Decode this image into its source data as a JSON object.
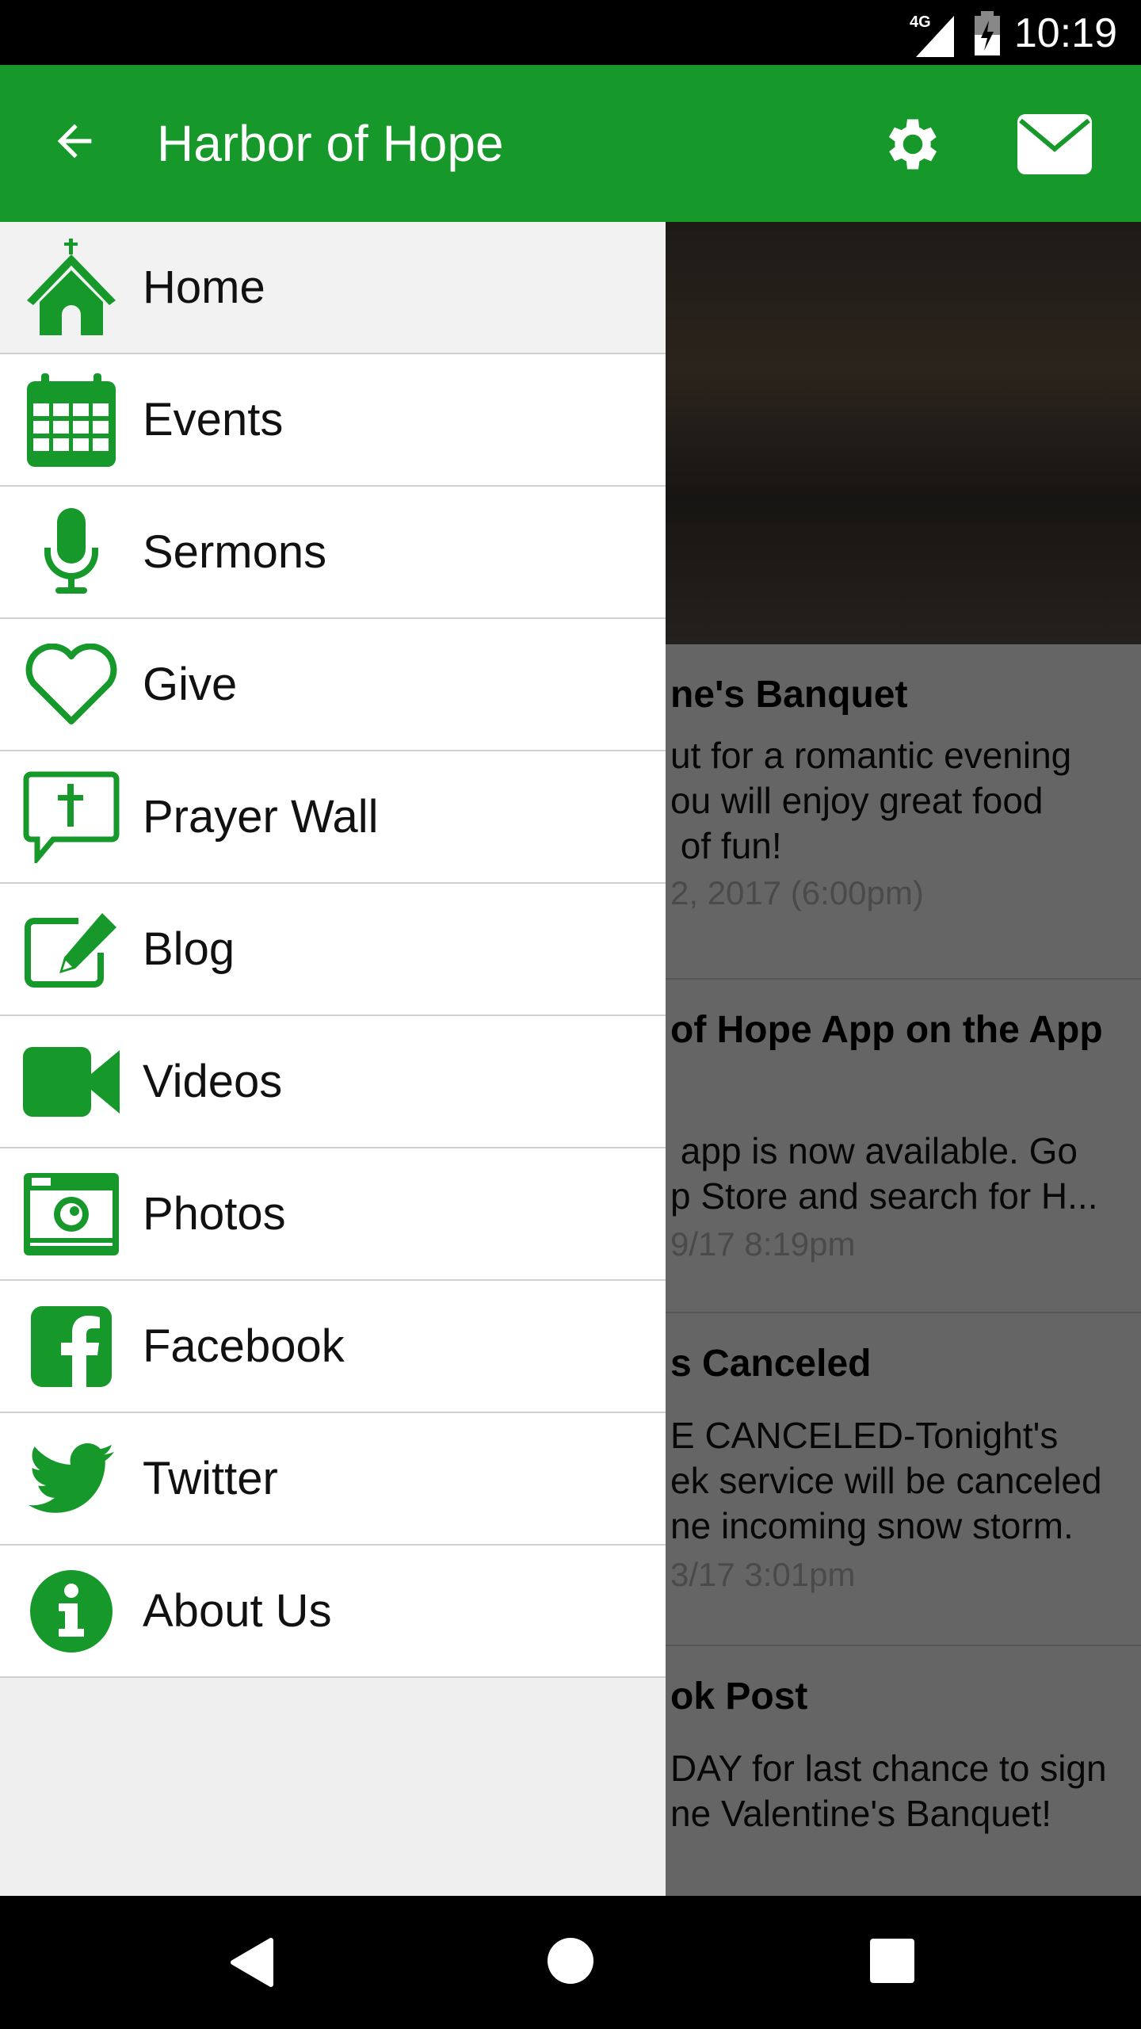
{
  "colors": {
    "accent": "#16982a"
  },
  "status_bar": {
    "network": "4G",
    "time": "10:19"
  },
  "app_bar": {
    "title": "Harbor of Hope",
    "icons": [
      "arrow-back-icon",
      "gear-icon",
      "mail-icon"
    ]
  },
  "drawer": {
    "items": [
      {
        "label": "Home",
        "icon": "home-church-icon",
        "active": true
      },
      {
        "label": "Events",
        "icon": "calendar-icon"
      },
      {
        "label": "Sermons",
        "icon": "microphone-icon"
      },
      {
        "label": "Give",
        "icon": "heart-icon"
      },
      {
        "label": "Prayer Wall",
        "icon": "chat-cross-icon"
      },
      {
        "label": "Blog",
        "icon": "edit-icon"
      },
      {
        "label": "Videos",
        "icon": "video-camera-icon"
      },
      {
        "label": "Photos",
        "icon": "camera-icon"
      },
      {
        "label": "Facebook",
        "icon": "facebook-icon"
      },
      {
        "label": "Twitter",
        "icon": "twitter-icon"
      },
      {
        "label": "About Us",
        "icon": "info-icon"
      }
    ]
  },
  "posts": [
    {
      "title": "ne's Banquet",
      "body": "ut for a romantic evening\nou will enjoy great food\n of fun!",
      "date": "2, 2017 (6:00pm)"
    },
    {
      "title": "of Hope App on the App",
      "body": " app is now available. Go\np Store and search for H...",
      "date": "9/17 8:19pm"
    },
    {
      "title": "s Canceled",
      "body": "E CANCELED-Tonight's\nek service will be canceled\nne incoming snow storm.",
      "date": "3/17 3:01pm"
    },
    {
      "title": "ok Post",
      "body": "DAY for last chance to sign\nne Valentine's Banquet!",
      "date": ""
    }
  ]
}
